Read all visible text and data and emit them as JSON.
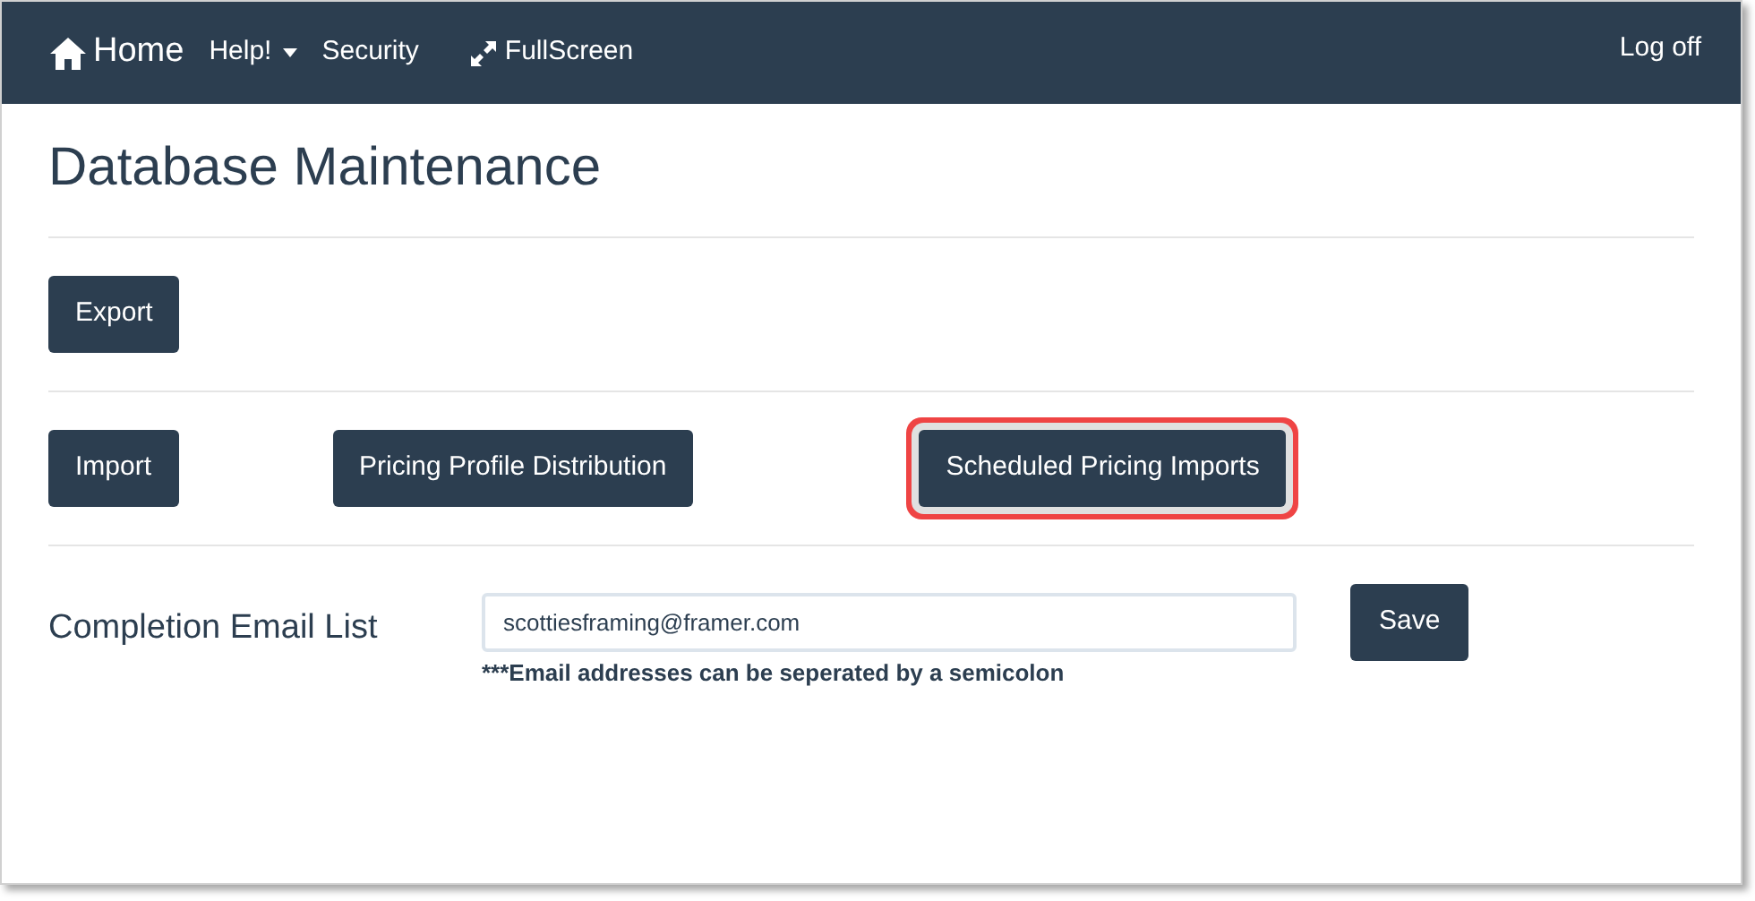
{
  "navbar": {
    "brand": "Home",
    "items": [
      {
        "label": "Help!",
        "kind": "dropdown"
      },
      {
        "label": "Security",
        "kind": "link"
      },
      {
        "label": "FullScreen",
        "kind": "fullscreen"
      }
    ],
    "right": "Log off"
  },
  "title": "Database Maintenance",
  "button_rows": [
    {
      "buttons": [
        {
          "label": "Export",
          "highlighted": false
        }
      ]
    },
    {
      "buttons": [
        {
          "label": "Import",
          "highlighted": false
        },
        {
          "label": "Pricing Profile Distribution",
          "highlighted": false
        },
        {
          "label": "Scheduled Pricing Imports",
          "highlighted": true
        }
      ]
    }
  ],
  "email": {
    "label": "Completion Email List",
    "value": "scottiesframing@framer.com",
    "hint": "***Email addresses can be seperated by a semicolon",
    "button": "Save"
  }
}
